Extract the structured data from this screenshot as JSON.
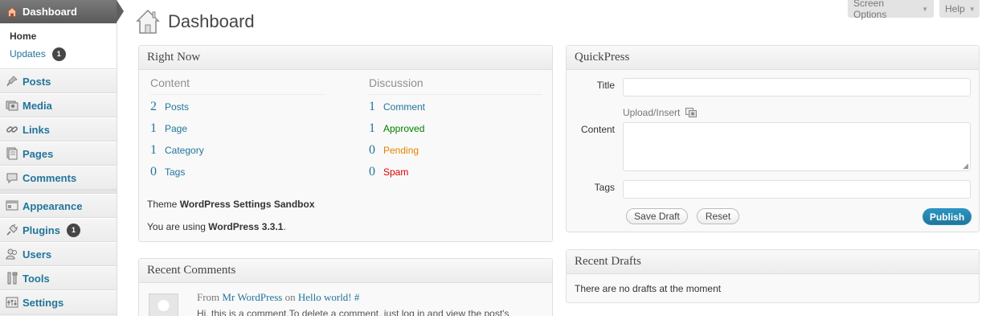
{
  "sidebar": {
    "dashboard_label": "Dashboard",
    "home_label": "Home",
    "updates_label": "Updates",
    "updates_count": "1",
    "items": [
      {
        "label": "Posts",
        "icon": "pushpin-icon"
      },
      {
        "label": "Media",
        "icon": "media-icon"
      },
      {
        "label": "Links",
        "icon": "link-icon"
      },
      {
        "label": "Pages",
        "icon": "pages-icon"
      },
      {
        "label": "Comments",
        "icon": "comment-icon"
      },
      {
        "label": "Appearance",
        "icon": "appearance-icon"
      },
      {
        "label": "Plugins",
        "icon": "plug-icon",
        "count": "1"
      },
      {
        "label": "Users",
        "icon": "users-icon"
      },
      {
        "label": "Tools",
        "icon": "tools-icon"
      },
      {
        "label": "Settings",
        "icon": "settings-icon"
      }
    ]
  },
  "header": {
    "title": "Dashboard",
    "screen_options": "Screen Options",
    "help": "Help"
  },
  "right_now": {
    "title": "Right Now",
    "content_heading": "Content",
    "discussion_heading": "Discussion",
    "content": [
      {
        "num": "2",
        "label": "Posts"
      },
      {
        "num": "1",
        "label": "Page"
      },
      {
        "num": "1",
        "label": "Category"
      },
      {
        "num": "0",
        "label": "Tags"
      }
    ],
    "discussion": [
      {
        "num": "1",
        "label": "Comment"
      },
      {
        "num": "1",
        "label": "Approved"
      },
      {
        "num": "0",
        "label": "Pending"
      },
      {
        "num": "0",
        "label": "Spam"
      }
    ],
    "theme_prefix": "Theme",
    "theme_name": "WordPress Settings Sandbox",
    "version_prefix": "You are using",
    "version": "WordPress 3.3.1",
    "version_suffix": "."
  },
  "recent_comments": {
    "title": "Recent Comments",
    "from": "From",
    "author": "Mr WordPress",
    "on": "on",
    "post": "Hello world!",
    "hash": "#",
    "excerpt": "Hi, this is a comment.To delete a comment, just log in and view the post's"
  },
  "quickpress": {
    "title": "QuickPress",
    "title_label": "Title",
    "upload_label": "Upload/Insert",
    "content_label": "Content",
    "tags_label": "Tags",
    "save_draft": "Save Draft",
    "reset": "Reset",
    "publish": "Publish"
  },
  "recent_drafts": {
    "title": "Recent Drafts",
    "empty_text": "There are no drafts at the moment"
  },
  "colors": {
    "link": "#21759b",
    "approved": "#008000",
    "pending": "#e28300",
    "spam": "#dd0000",
    "publish": "#21759b"
  }
}
